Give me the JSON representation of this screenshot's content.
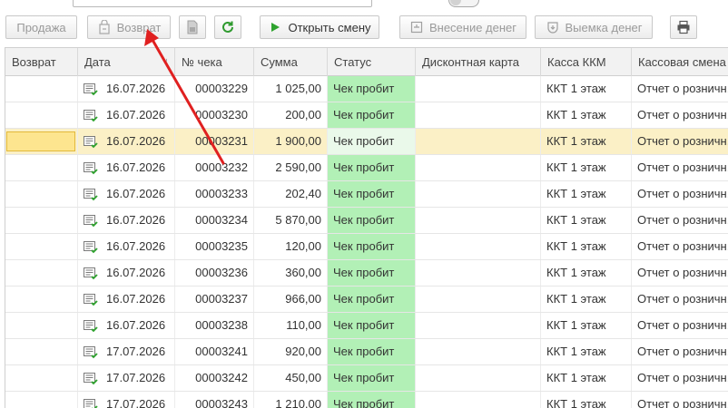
{
  "toolbar": {
    "sell_label": "Продажа",
    "return_label": "Возврат",
    "open_shift_label": "Открыть смену",
    "deposit_label": "Внесение денег",
    "withdraw_label": "Выемка денег"
  },
  "table": {
    "headers": {
      "ret": "Возврат",
      "date": "Дата",
      "num": "№ чека",
      "sum": "Сумма",
      "status": "Статус",
      "card": "Дисконтная карта",
      "kkm": "Касса ККМ",
      "shift": "Кассовая смена"
    },
    "rows": [
      {
        "ret": "",
        "date": "16.07.2026",
        "num": "00003229",
        "sum": "1 025,00",
        "status": "Чек пробит",
        "card": "",
        "kkm": "ККТ 1 этаж",
        "shift": "Отчет о розничн."
      },
      {
        "ret": "",
        "date": "16.07.2026",
        "num": "00003230",
        "sum": "200,00",
        "status": "Чек пробит",
        "card": "",
        "kkm": "ККТ 1 этаж",
        "shift": "Отчет о розничн."
      },
      {
        "ret": "",
        "date": "16.07.2026",
        "num": "00003231",
        "sum": "1 900,00",
        "status": "Чек пробит",
        "card": "",
        "kkm": "ККТ 1 этаж",
        "shift": "Отчет о розничн."
      },
      {
        "ret": "",
        "date": "16.07.2026",
        "num": "00003232",
        "sum": "2 590,00",
        "status": "Чек пробит",
        "card": "",
        "kkm": "ККТ 1 этаж",
        "shift": "Отчет о розничн."
      },
      {
        "ret": "",
        "date": "16.07.2026",
        "num": "00003233",
        "sum": "202,40",
        "status": "Чек пробит",
        "card": "",
        "kkm": "ККТ 1 этаж",
        "shift": "Отчет о розничн."
      },
      {
        "ret": "",
        "date": "16.07.2026",
        "num": "00003234",
        "sum": "5 870,00",
        "status": "Чек пробит",
        "card": "",
        "kkm": "ККТ 1 этаж",
        "shift": "Отчет о розничн."
      },
      {
        "ret": "",
        "date": "16.07.2026",
        "num": "00003235",
        "sum": "120,00",
        "status": "Чек пробит",
        "card": "",
        "kkm": "ККТ 1 этаж",
        "shift": "Отчет о розничн."
      },
      {
        "ret": "",
        "date": "16.07.2026",
        "num": "00003236",
        "sum": "360,00",
        "status": "Чек пробит",
        "card": "",
        "kkm": "ККТ 1 этаж",
        "shift": "Отчет о розничн."
      },
      {
        "ret": "",
        "date": "16.07.2026",
        "num": "00003237",
        "sum": "966,00",
        "status": "Чек пробит",
        "card": "",
        "kkm": "ККТ 1 этаж",
        "shift": "Отчет о розничн."
      },
      {
        "ret": "",
        "date": "16.07.2026",
        "num": "00003238",
        "sum": "110,00",
        "status": "Чек пробит",
        "card": "",
        "kkm": "ККТ 1 этаж",
        "shift": "Отчет о розничн."
      },
      {
        "ret": "",
        "date": "17.07.2026",
        "num": "00003241",
        "sum": "920,00",
        "status": "Чек пробит",
        "card": "",
        "kkm": "ККТ 1 этаж",
        "shift": "Отчет о розничн."
      },
      {
        "ret": "",
        "date": "17.07.2026",
        "num": "00003242",
        "sum": "450,00",
        "status": "Чек пробит",
        "card": "",
        "kkm": "ККТ 1 этаж",
        "shift": "Отчет о розничн."
      },
      {
        "ret": "",
        "date": "17.07.2026",
        "num": "00003243",
        "sum": "1 210,00",
        "status": "Чек пробит",
        "card": "",
        "kkm": "ККТ 1 этаж",
        "shift": "Отчет о розничн."
      }
    ]
  },
  "selected_row_index": 2,
  "colors": {
    "status_green": "#b2f0b6",
    "selected_row": "#fbf0c6",
    "annotation_arrow": "#e02020"
  },
  "icons": {
    "return": "return-icon",
    "document": "document-icon",
    "refresh": "refresh-icon",
    "play": "play-icon",
    "deposit": "deposit-icon",
    "withdraw": "withdraw-icon",
    "print": "printer-icon",
    "row": "receipt-check-icon"
  }
}
